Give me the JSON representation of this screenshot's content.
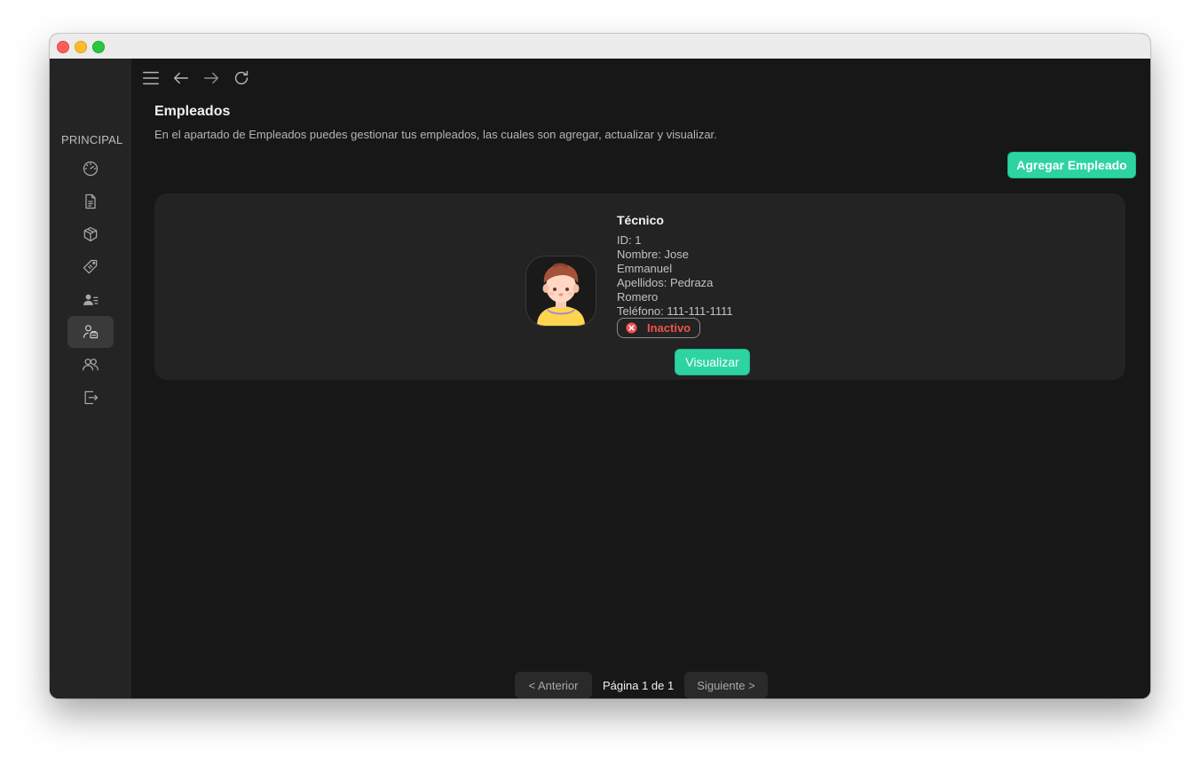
{
  "sidebar": {
    "section_title": "PRINCIPAL",
    "items": [
      {
        "icon": "dashboard-icon"
      },
      {
        "icon": "document-icon"
      },
      {
        "icon": "box-icon"
      },
      {
        "icon": "tag-icon"
      },
      {
        "icon": "user-list-icon"
      },
      {
        "icon": "employee-icon",
        "active": true
      },
      {
        "icon": "users-icon"
      },
      {
        "icon": "logout-icon"
      }
    ]
  },
  "toolbar": {
    "icons": [
      "menu-icon",
      "back-arrow-icon",
      "forward-arrow-icon",
      "reload-icon"
    ]
  },
  "page": {
    "title": "Empleados",
    "description": "En el apartado de Empleados puedes gestionar tus empleados, las cuales son agregar, actualizar y visualizar.",
    "add_button": "Agregar Empleado"
  },
  "employees": [
    {
      "role": "Técnico",
      "id_line": "ID: 1",
      "name_line": "Nombre: Jose Emmanuel",
      "surname_line": "Apellidos: Pedraza Romero",
      "phone_line": "Teléfono: 111-111-1111",
      "status": "Inactivo",
      "view_button": "Visualizar"
    }
  ],
  "pagination": {
    "prev": "< Anterior",
    "label": "Página 1 de 1",
    "next": "Siguiente >"
  },
  "colors": {
    "accent": "#2ed3a3",
    "inactive": "#ef5350",
    "background": "#171717",
    "sidebar": "#242424"
  }
}
